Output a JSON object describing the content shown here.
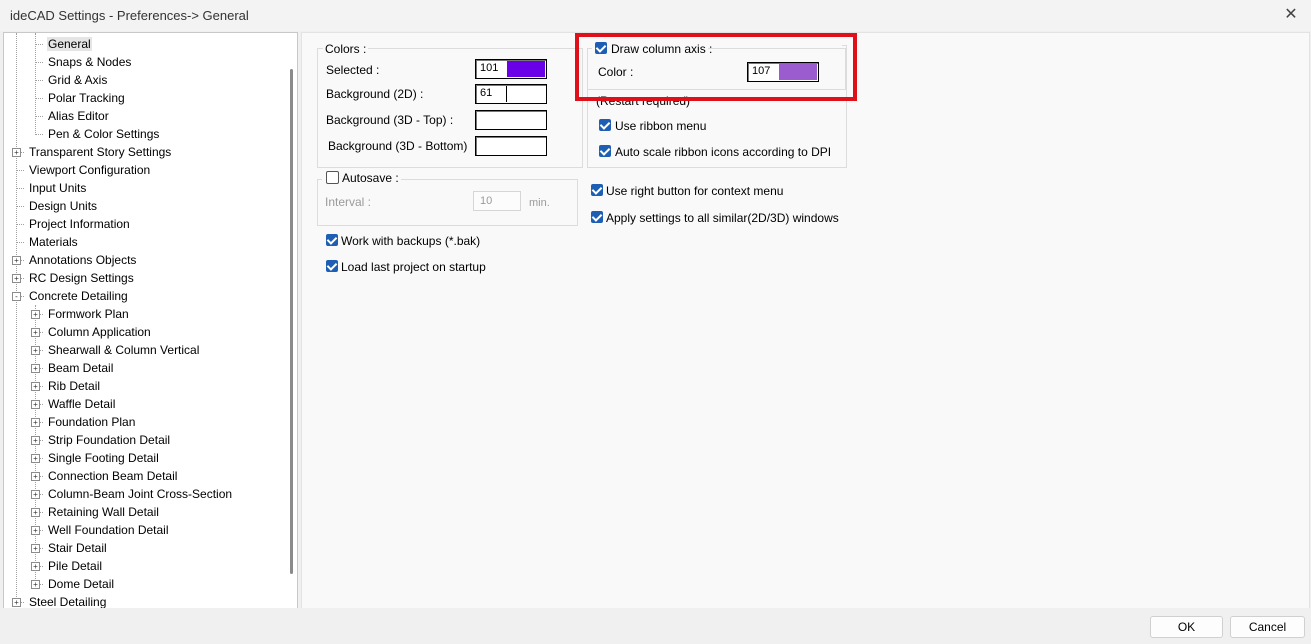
{
  "window": {
    "title": "ideCAD Settings - Preferences-> General",
    "close_icon": "close-icon"
  },
  "tree": {
    "items": [
      {
        "label": "General",
        "level": 2,
        "expander": "",
        "selected": true
      },
      {
        "label": "Snaps & Nodes",
        "level": 2,
        "expander": ""
      },
      {
        "label": "Grid & Axis",
        "level": 2,
        "expander": ""
      },
      {
        "label": "Polar Tracking",
        "level": 2,
        "expander": ""
      },
      {
        "label": "Alias Editor",
        "level": 2,
        "expander": ""
      },
      {
        "label": "Pen & Color Settings",
        "level": 2,
        "expander": ""
      },
      {
        "label": "Transparent Story Settings",
        "level": 1,
        "expander": "+"
      },
      {
        "label": "Viewport Configuration",
        "level": 1,
        "expander": ""
      },
      {
        "label": "Input Units",
        "level": 1,
        "expander": ""
      },
      {
        "label": "Design Units",
        "level": 1,
        "expander": ""
      },
      {
        "label": "Project Information",
        "level": 1,
        "expander": ""
      },
      {
        "label": "Materials",
        "level": 1,
        "expander": ""
      },
      {
        "label": "Annotations Objects",
        "level": 1,
        "expander": "+"
      },
      {
        "label": "RC Design Settings",
        "level": 1,
        "expander": "+"
      },
      {
        "label": "Concrete Detailing",
        "level": 1,
        "expander": "-"
      },
      {
        "label": "Formwork Plan",
        "level": 2,
        "expander": "+"
      },
      {
        "label": "Column Application",
        "level": 2,
        "expander": "+"
      },
      {
        "label": "Shearwall & Column Vertical",
        "level": 2,
        "expander": "+"
      },
      {
        "label": "Beam Detail",
        "level": 2,
        "expander": "+"
      },
      {
        "label": "Rib Detail",
        "level": 2,
        "expander": "+"
      },
      {
        "label": "Waffle Detail",
        "level": 2,
        "expander": "+"
      },
      {
        "label": "Foundation Plan",
        "level": 2,
        "expander": "+"
      },
      {
        "label": "Strip Foundation Detail",
        "level": 2,
        "expander": "+"
      },
      {
        "label": "Single Footing Detail",
        "level": 2,
        "expander": "+"
      },
      {
        "label": "Connection Beam Detail",
        "level": 2,
        "expander": "+"
      },
      {
        "label": "Column-Beam Joint Cross-Section",
        "level": 2,
        "expander": "+"
      },
      {
        "label": "Retaining Wall Detail",
        "level": 2,
        "expander": "+"
      },
      {
        "label": "Well Foundation Detail",
        "level": 2,
        "expander": "+"
      },
      {
        "label": "Stair Detail",
        "level": 2,
        "expander": "+"
      },
      {
        "label": "Pile Detail",
        "level": 2,
        "expander": "+"
      },
      {
        "label": "Dome Detail",
        "level": 2,
        "expander": "+"
      },
      {
        "label": "Steel Detailing",
        "level": 1,
        "expander": "+"
      }
    ]
  },
  "colors": {
    "group_label": "Colors :",
    "rows": [
      {
        "label": "Selected :",
        "value": "101",
        "swatch": "#6a00e8"
      },
      {
        "label": "Background (2D) :",
        "value": "61",
        "swatch": "#ffffff"
      },
      {
        "label": "Background (3D - Top) :",
        "value": "",
        "swatch": "#ffffff"
      },
      {
        "label": "Background (3D - Bottom)",
        "value": "",
        "swatch": "#ffffff"
      }
    ]
  },
  "autosave": {
    "label": "Autosave :",
    "checked": false,
    "interval_label": "Interval :",
    "interval_value": "10",
    "unit": "min."
  },
  "left_checks": [
    {
      "label": "Work with backups (*.bak)",
      "checked": true
    },
    {
      "label": "Load last project on startup",
      "checked": true
    }
  ],
  "column_axis": {
    "label": "Draw column axis :",
    "checked": true,
    "color_label": "Color :",
    "color_value": "107",
    "swatch": "#9b5ccf"
  },
  "ribbon": {
    "restart_note": "(Restart required)",
    "checks": [
      {
        "label": "Use ribbon menu",
        "checked": true
      },
      {
        "label": "Auto scale ribbon icons according to DPI",
        "checked": true
      }
    ]
  },
  "right_checks": [
    {
      "label": "Use right button for context menu",
      "checked": true
    },
    {
      "label": "Apply settings to all similar(2D/3D) windows",
      "checked": true
    }
  ],
  "footer": {
    "ok": "OK",
    "cancel": "Cancel"
  },
  "theme": {
    "highlight": "#e0101a",
    "checkbox": "#1e5fb4"
  }
}
